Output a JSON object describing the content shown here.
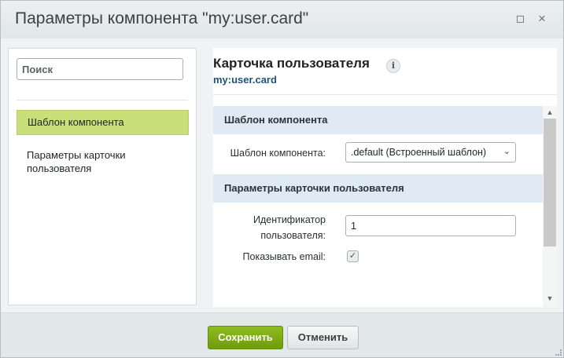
{
  "dialog": {
    "title": "Параметры компонента \"my:user.card\"",
    "expand_icon": "expand-icon",
    "close_icon": "close-icon",
    "close_glyph": "×"
  },
  "sidebar": {
    "search_placeholder": "Поиск",
    "items": [
      {
        "label": "Шаблон компонента",
        "active": true
      },
      {
        "label": "Параметры карточки пользователя",
        "active": false
      }
    ]
  },
  "main": {
    "title": "Карточка пользователя",
    "info_icon": "info-icon",
    "info_glyph": "i",
    "subtitle": "my:user.card",
    "sections": [
      {
        "heading": "Шаблон компонента"
      },
      {
        "heading": "Параметры карточки пользователя"
      }
    ],
    "fields": {
      "template": {
        "label": "Шаблон компонента:",
        "value": ".default (Встроенный шаблон)"
      },
      "user_id": {
        "label": "Идентификатор пользователя:",
        "value": "1"
      },
      "show_email": {
        "label": "Показывать email:",
        "checked": true
      }
    }
  },
  "footer": {
    "save_label": "Сохранить",
    "cancel_label": "Отменить"
  },
  "colors": {
    "active_item": "#c8df7a",
    "section_bg": "#dfeaf4",
    "save_button": "#7aa814",
    "subtitle": "#22517b"
  }
}
